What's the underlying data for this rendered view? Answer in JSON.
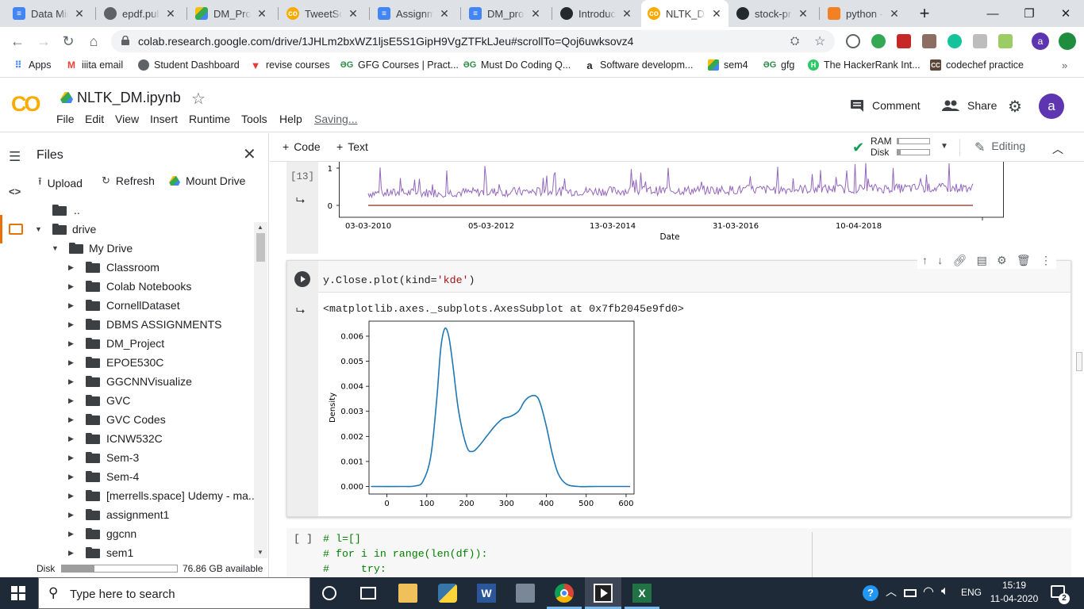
{
  "browser": {
    "tabs": [
      {
        "title": "Data Mining",
        "icon": "docs-icon"
      },
      {
        "title": "epdf.pub",
        "icon": "globe-icon"
      },
      {
        "title": "DM_Project",
        "icon": "drive-icon"
      },
      {
        "title": "TweetScraper",
        "icon": "colab-icon"
      },
      {
        "title": "Assignment",
        "icon": "docs-icon"
      },
      {
        "title": "DM_project",
        "icon": "docs-icon"
      },
      {
        "title": "Introduction",
        "icon": "github-icon"
      },
      {
        "title": "NLTK_DM",
        "icon": "colab-icon"
      },
      {
        "title": "stock-price",
        "icon": "github-icon"
      },
      {
        "title": "python -",
        "icon": "stackoverflow-icon"
      }
    ],
    "url": "colab.research.google.com/drive/1JHLm2bxWZ1ljsE5S1GipH9VgZTFkLJeu#scrollTo=Qoj6uwksovz4",
    "profile_initial": "a",
    "bookmarks": [
      {
        "label": "Apps"
      },
      {
        "label": "iiita email"
      },
      {
        "label": "Student Dashboard"
      },
      {
        "label": "revise courses"
      },
      {
        "label": "GFG Courses | Pract..."
      },
      {
        "label": "Must Do Coding Q..."
      },
      {
        "label": "Software developm..."
      },
      {
        "label": "sem4"
      },
      {
        "label": "gfg"
      },
      {
        "label": "The HackerRank Int..."
      },
      {
        "label": "codechef practice"
      }
    ]
  },
  "colab": {
    "logo": "CO",
    "notebook_title": "NLTK_DM.ipynb",
    "menu": [
      "File",
      "Edit",
      "View",
      "Insert",
      "Runtime",
      "Tools",
      "Help"
    ],
    "status": "Saving...",
    "comment_label": "Comment",
    "share_label": "Share",
    "avatar_initial": "a",
    "add_code_label": "Code",
    "add_text_label": "Text",
    "ram_label": "RAM",
    "disk_label": "Disk",
    "ram_fill": 0.05,
    "disk_fill": 0.1,
    "editing_label": "Editing"
  },
  "files_panel": {
    "title": "Files",
    "upload_label": "Upload",
    "refresh_label": "Refresh",
    "mount_label": "Mount Drive",
    "parent_label": "..",
    "root_label": "drive",
    "mydrive_label": "My Drive",
    "folders": [
      "Classroom",
      "Colab Notebooks",
      "CornellDataset",
      "DBMS ASSIGNMENTS",
      "DM_Project",
      "EPOE530C",
      "GGCNNVisualize",
      "GVC",
      "GVC Codes",
      "ICNW532C",
      "Sem-3",
      "Sem-4",
      "[merrells.space] Udemy - ma...",
      "assignment1",
      "ggcnn",
      "sem1"
    ],
    "disk_label": "Disk",
    "disk_available": "76.86 GB available",
    "disk_fill": 0.28
  },
  "cells": {
    "prev_exec_count": "[13]",
    "prev_plot": {
      "y_ticks": [
        "1",
        "0"
      ],
      "x_ticks": [
        "03-03-2010",
        "05-03-2012",
        "13-03-2014",
        "31-03-2016",
        "10-04-2018"
      ],
      "xlabel": "Date"
    },
    "kde_cell": {
      "code_prefix": "y.Close.plot(kind=",
      "code_string": "'kde'",
      "code_suffix": ")",
      "output_text": "<matplotlib.axes._subplots.AxesSubplot at 0x7fb2045e9fd0>"
    },
    "next_cell": {
      "exec_label": "[ ]",
      "lines": [
        "# l=[]",
        "# for i in range(len(df)):",
        "#     try:"
      ]
    }
  },
  "chart_data": {
    "type": "line",
    "title": "",
    "xlabel": "",
    "ylabel": "Density",
    "xlim": [
      -45,
      620
    ],
    "ylim": [
      -0.0003,
      0.0066
    ],
    "x_ticks": [
      0,
      100,
      200,
      300,
      400,
      500,
      600
    ],
    "y_ticks": [
      0.0,
      0.001,
      0.002,
      0.003,
      0.004,
      0.005,
      0.006
    ],
    "y_tick_labels": [
      "0.000",
      "0.001",
      "0.002",
      "0.003",
      "0.004",
      "0.005",
      "0.006"
    ],
    "color": "#1f77b4",
    "x": [
      -40,
      40,
      70,
      90,
      110,
      125,
      135,
      145,
      155,
      165,
      180,
      200,
      215,
      230,
      250,
      270,
      290,
      310,
      330,
      345,
      360,
      375,
      385,
      400,
      415,
      430,
      450,
      480,
      520,
      560,
      610
    ],
    "y": [
      0.0,
      0.0,
      2e-05,
      0.0002,
      0.0012,
      0.0035,
      0.0055,
      0.0063,
      0.006,
      0.0049,
      0.003,
      0.0016,
      0.0014,
      0.0016,
      0.002,
      0.0024,
      0.0027,
      0.0028,
      0.003,
      0.0034,
      0.0036,
      0.0036,
      0.0033,
      0.0024,
      0.0013,
      0.0005,
      0.0001,
      0.0,
      0.0,
      0.0,
      0.0
    ]
  },
  "taskbar": {
    "search_placeholder": "Type here to search",
    "language": "ENG",
    "time": "15:19",
    "date": "11-04-2020",
    "notification_count": "2"
  }
}
